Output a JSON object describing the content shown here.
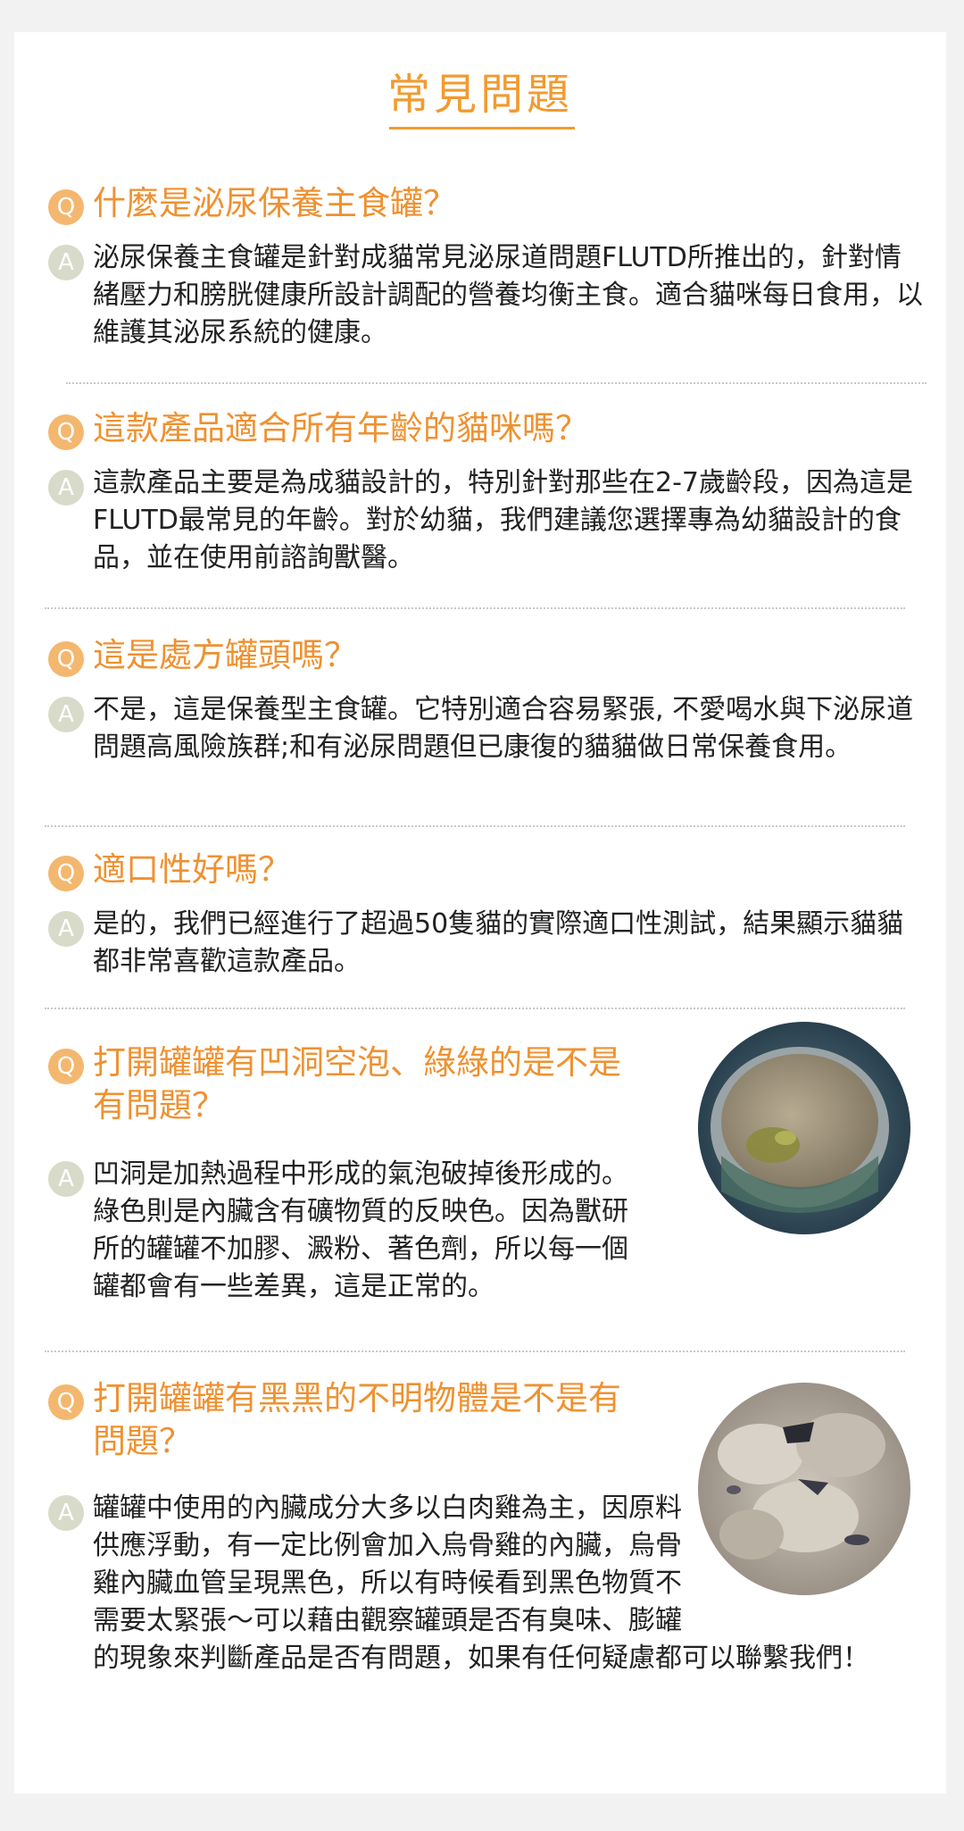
{
  "page_title": "常見問題",
  "badges": {
    "q": "Q",
    "a": "A"
  },
  "faq": [
    {
      "question": "什麼是泌尿保養主食罐？",
      "answer": "泌尿保養主食罐是針對成貓常見泌尿道問題FLUTD所推出的，針對情緒壓力和膀胱健康所設計調配的營養均衡主食。適合貓咪每日食用，以維護其泌尿系統的健康。"
    },
    {
      "question": "這款產品適合所有年齡的貓咪嗎？",
      "answer": "這款產品主要是為成貓設計的，特別針對那些在2-7歲齡段，因為這是FLUTD最常見的年齡。對於幼貓，我們建議您選擇專為幼貓設計的食品，並在使用前諮詢獸醫。"
    },
    {
      "question": "這是處方罐頭嗎？",
      "answer": "不是，這是保養型主食罐。它特別適合容易緊張, 不愛喝水與下泌尿道問題高風險族群;和有泌尿問題但已康復的貓貓做日常保養食用。"
    },
    {
      "question": "適口性好嗎？",
      "answer": "是的，我們已經進行了超過50隻貓的實際適口性測試，結果顯示貓貓都非常喜歡這款產品。"
    },
    {
      "question": "打開罐罐有凹洞空泡、綠綠的是不是有問題？",
      "answer": "凹洞是加熱過程中形成的氣泡破掉後形成的。綠色則是內臟含有礦物質的反映色。因為獸研所的罐罐不加膠、澱粉、著色劑，所以每一個罐都會有一些差異，這是正常的。"
    },
    {
      "question": "打開罐罐有黑黑的不明物體是不是有問題？",
      "answer": "罐罐中使用的內臟成分大多以白肉雞為主，因原料供應浮動，有一定比例會加入烏骨雞的內臟，烏骨雞內臟血管呈現黑色，所以有時候看到黑色物質不需要太緊張～可以藉由觀察罐頭是否有臭味、膨罐的現象來判斷產品是否有問題，如果有任何疑慮都可以聯繫我們！"
    }
  ],
  "colors": {
    "accent": "#ef9130",
    "q_badge": "#f4b76f",
    "a_badge": "#d8dbc9",
    "text": "#222222"
  }
}
